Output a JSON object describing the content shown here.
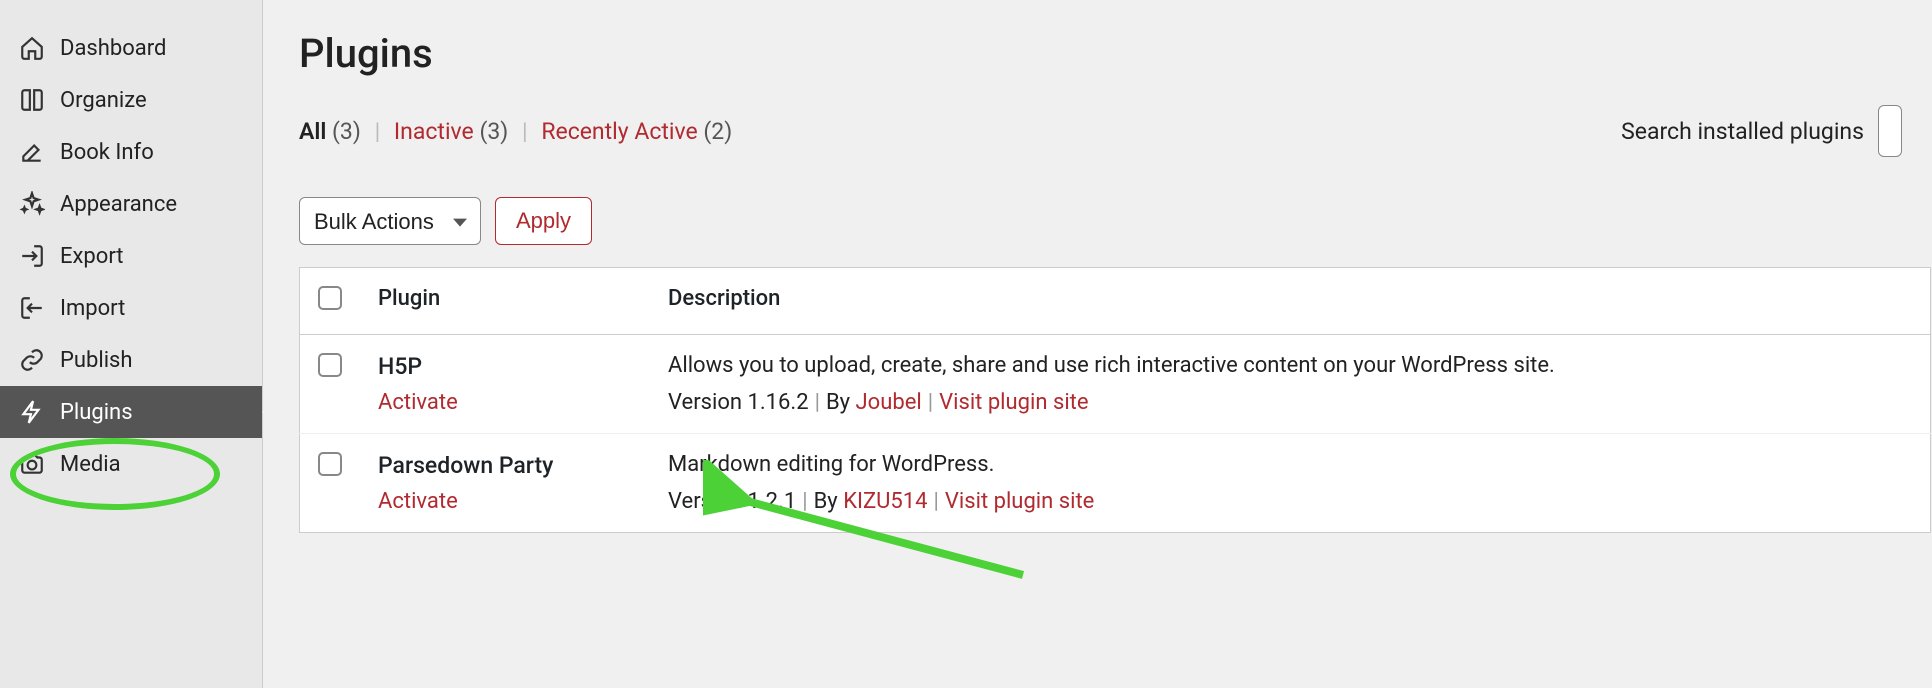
{
  "sidebar": {
    "items": [
      {
        "label": "Dashboard"
      },
      {
        "label": "Organize"
      },
      {
        "label": "Book Info"
      },
      {
        "label": "Appearance"
      },
      {
        "label": "Export"
      },
      {
        "label": "Import"
      },
      {
        "label": "Publish"
      },
      {
        "label": "Plugins"
      },
      {
        "label": "Media"
      }
    ]
  },
  "page": {
    "title": "Plugins"
  },
  "filters": {
    "all_label": "All",
    "all_count": "(3)",
    "inactive_label": "Inactive",
    "inactive_count": "(3)",
    "recent_label": "Recently Active",
    "recent_count": "(2)"
  },
  "search": {
    "label": "Search installed plugins",
    "value": ""
  },
  "bulk": {
    "select_label": "Bulk Actions",
    "apply_label": "Apply"
  },
  "table": {
    "head_plugin": "Plugin",
    "head_description": "Description",
    "rows": [
      {
        "name": "H5P",
        "action": "Activate",
        "desc": "Allows you to upload, create, share and use rich interactive content on your WordPress site.",
        "version_label": "Version 1.16.2",
        "by_label": "By",
        "author": "Joubel",
        "visit": "Visit plugin site"
      },
      {
        "name": "Parsedown Party",
        "action": "Activate",
        "desc": "Markdown editing for WordPress.",
        "version_label": "Version 1.2.1",
        "by_label": "By",
        "author": "KIZU514",
        "visit": "Visit plugin site"
      }
    ]
  }
}
